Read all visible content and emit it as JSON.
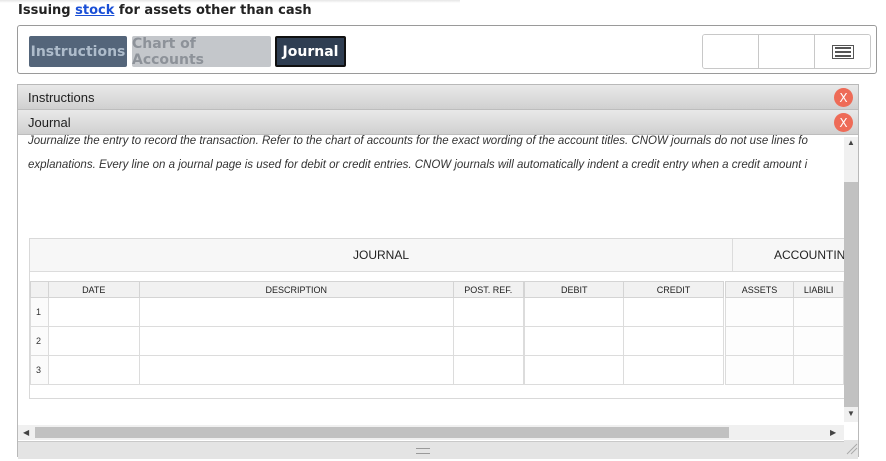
{
  "page": {
    "title_prefix": "Issuing ",
    "title_link": "stock",
    "title_suffix": " for assets other than cash"
  },
  "tabs": {
    "instructions": "Instructions",
    "chart_of_accounts": "Chart of Accounts",
    "journal": "Journal"
  },
  "panels": {
    "instructions_header": "Instructions",
    "journal_header": "Journal",
    "close_label": "X"
  },
  "instructions_text": {
    "line1": "Journalize the entry to record the transaction. Refer to the chart of accounts for the exact wording of the account titles. CNOW journals do not use lines fo",
    "line2": "explanations. Every line on a journal page is used for debit or credit entries. CNOW journals will automatically indent a credit entry when a credit amount i"
  },
  "journal": {
    "section_journal": "JOURNAL",
    "section_accounting": "ACCOUNTINC",
    "columns": {
      "date": "DATE",
      "description": "DESCRIPTION",
      "post_ref": "POST. REF.",
      "debit": "DEBIT",
      "credit": "CREDIT",
      "assets": "ASSETS",
      "liabilities": "LIABILI"
    },
    "rows": [
      "1",
      "2",
      "3"
    ]
  }
}
